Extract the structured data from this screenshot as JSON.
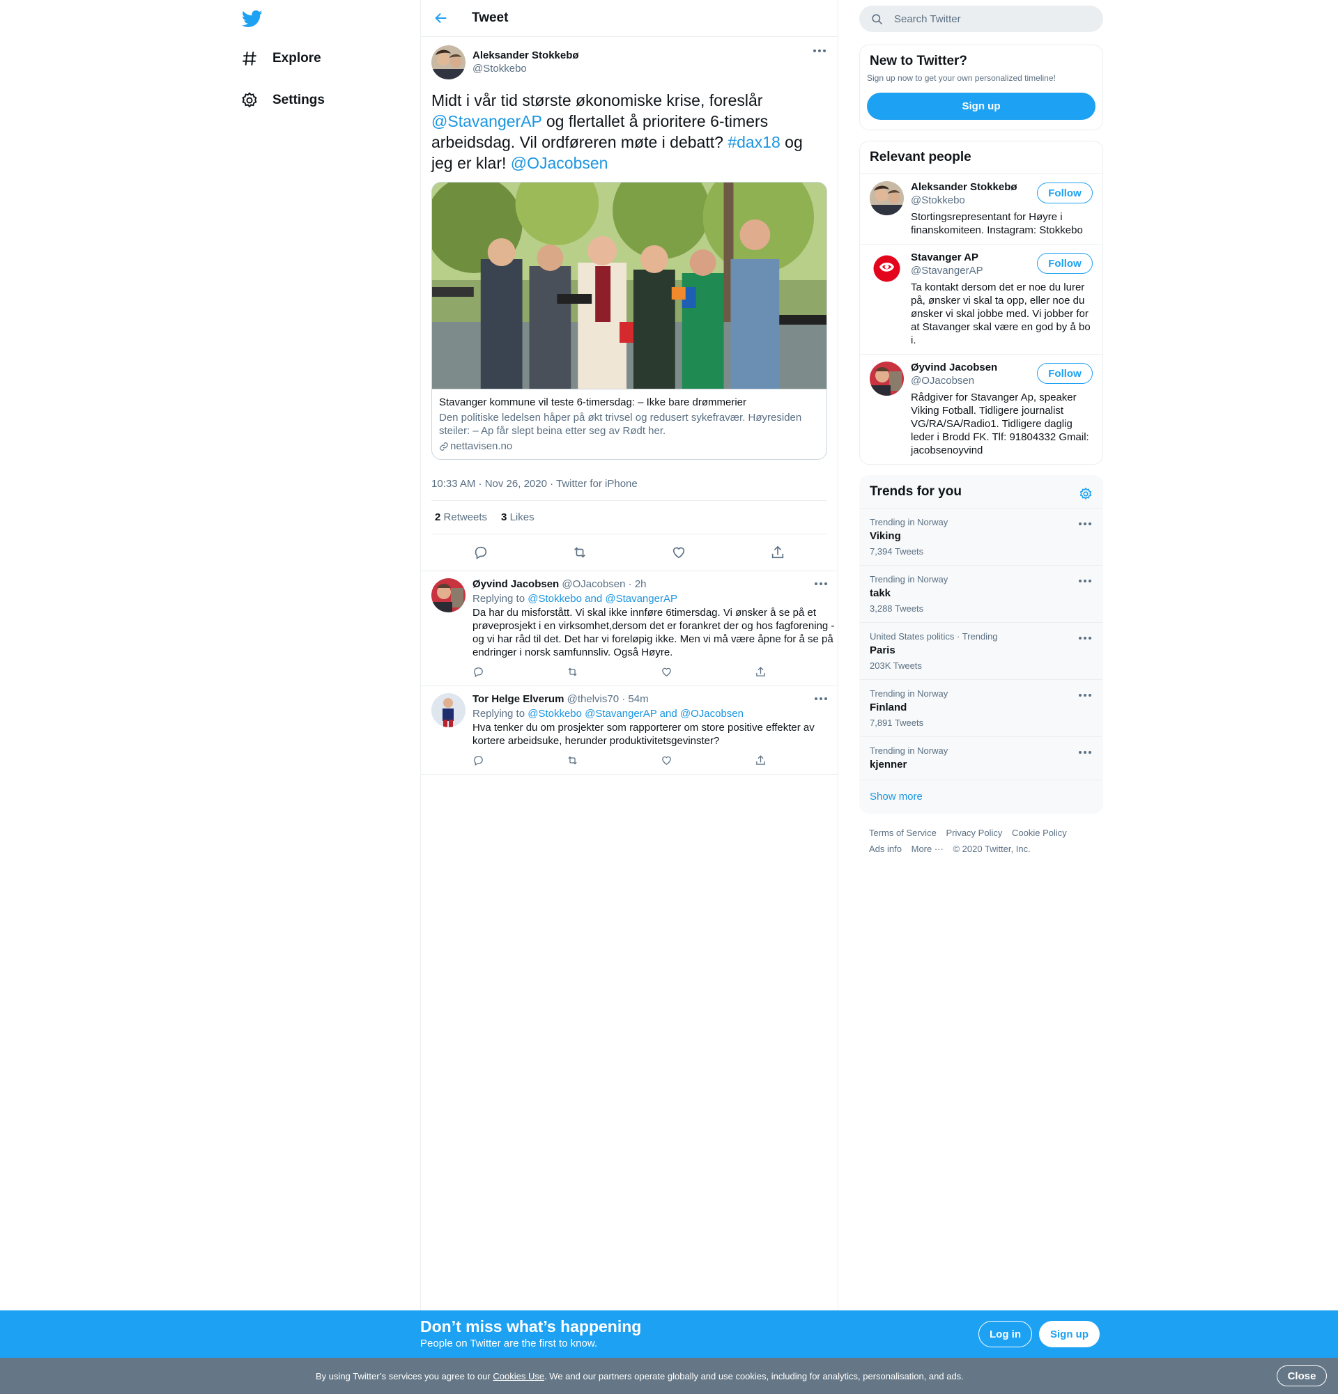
{
  "nav": {
    "explore": "Explore",
    "settings": "Settings"
  },
  "header": {
    "title": "Tweet"
  },
  "tweet": {
    "author_name": "Aleksander Stokkebø",
    "author_handle": "@Stokkebo",
    "text_parts": [
      {
        "t": "Midt i vår tid største økonomiske krise, foreslår ",
        "link": false
      },
      {
        "t": "@StavangerAP",
        "link": true
      },
      {
        "t": " og flertallet å prioritere 6-timers arbeidsdag. Vil ordføreren møte i debatt? ",
        "link": false
      },
      {
        "t": "#dax18",
        "link": true
      },
      {
        "t": " og jeg er klar! ",
        "link": false
      },
      {
        "t": "@OJacobsen",
        "link": true
      }
    ],
    "card": {
      "title": "Stavanger kommune vil teste 6-timersdag: – Ikke bare drømmerier",
      "description": "Den politiske ledelsen håper på økt trivsel og redusert sykefravær. Høyresiden steiler: – Ap får slept beina etter seg av Rødt her.",
      "domain": "nettavisen.no"
    },
    "timestamp": "10:33 AM · Nov 26, 2020 · Twitter for iPhone",
    "retweets": "2",
    "retweets_label": "Retweets",
    "likes": "3",
    "likes_label": "Likes"
  },
  "replies": [
    {
      "name": "Øyvind Jacobsen",
      "handle": "@OJacobsen",
      "time": "· 2h",
      "replying_prefix": "Replying to ",
      "replying_to": "@Stokkebo and @StavangerAP",
      "text": "Da har du misforstått. Vi skal ikke innføre 6timersdag. Vi ønsker å se på et prøveprosjekt i en virksomhet,dersom det er forankret der og hos fagforening - og vi har råd til det. Det har vi foreløpig ikke. Men vi må være åpne for å se på endringer i norsk samfunnsliv. Også Høyre."
    },
    {
      "name": "Tor Helge Elverum",
      "handle": "@thelvis70",
      "time": "· 54m",
      "replying_prefix": "Replying to ",
      "replying_to": "@Stokkebo @StavangerAP and @OJacobsen",
      "text": "Hva tenker du om prosjekter som rapporterer om store positive effekter av kortere arbeidsuke, herunder produktivitetsgevinster?"
    }
  ],
  "search": {
    "placeholder": "Search Twitter"
  },
  "new_to_twitter": {
    "title": "New to Twitter?",
    "subtitle": "Sign up now to get your own personalized timeline!",
    "button": "Sign up"
  },
  "relevant": {
    "title": "Relevant people",
    "follow_label": "Follow",
    "people": [
      {
        "name": "Aleksander Stokkebø",
        "handle": "@Stokkebo",
        "bio": "Stortingsrepresentant for Høyre i finanskomiteen. Instagram: Stokkebo"
      },
      {
        "name": "Stavanger AP",
        "handle": "@StavangerAP",
        "bio": "Ta kontakt dersom det er noe du lurer på, ønsker vi skal ta opp, eller noe du ønsker vi skal jobbe med. Vi jobber for at Stavanger skal være en god by å bo i."
      },
      {
        "name": "Øyvind Jacobsen",
        "handle": "@OJacobsen",
        "bio": "Rådgiver for Stavanger Ap, speaker Viking Fotball. Tidligere journalist VG/RA/SA/Radio1. Tidligere daglig leder i Brodd FK. Tlf: 91804332 Gmail: jacobsenoyvind"
      }
    ]
  },
  "trends": {
    "title": "Trends for you",
    "items": [
      {
        "context": "Trending in Norway",
        "name": "Viking",
        "count": "7,394 Tweets"
      },
      {
        "context": "Trending in Norway",
        "name": "takk",
        "count": "3,288 Tweets"
      },
      {
        "context": "United States politics · Trending",
        "name": "Paris",
        "count": "203K Tweets"
      },
      {
        "context": "Trending in Norway",
        "name": "Finland",
        "count": "7,891 Tweets"
      },
      {
        "context": "Trending in Norway",
        "name": "kjenner",
        "count": ""
      }
    ],
    "show_more": "Show more"
  },
  "footer": {
    "links": [
      "Terms of Service",
      "Privacy Policy",
      "Cookie Policy",
      "Ads info",
      "More ···",
      "© 2020 Twitter, Inc."
    ]
  },
  "banner": {
    "title": "Don’t miss what’s happening",
    "subtitle": "People on Twitter are the first to know.",
    "login": "Log in",
    "signup": "Sign up"
  },
  "cookie": {
    "prefix": "By using Twitter’s services you agree to our ",
    "link": "Cookies Use",
    "suffix": ". We and our partners operate globally and use cookies, including for analytics, personalisation, and ads.",
    "close": "Close"
  },
  "colors": {
    "accent": "#1da1f2",
    "link": "#1b95e0",
    "muted": "#5b7083",
    "cookie_bar": "#657786"
  }
}
